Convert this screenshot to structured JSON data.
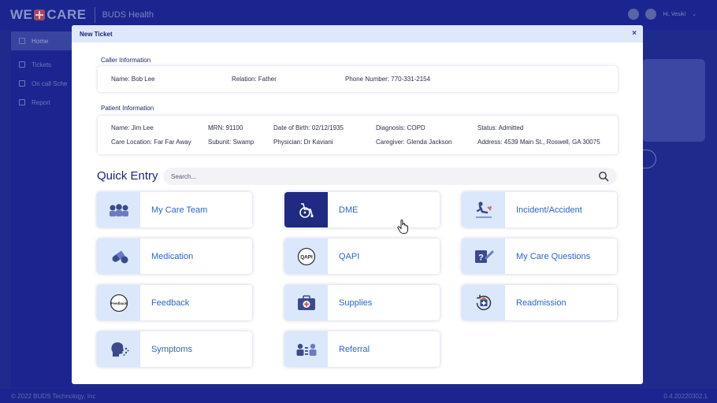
{
  "app": {
    "logo_text_left": "WE",
    "logo_text_right": "CARE",
    "brand": "BUDS Health",
    "greeting": "Hi, Vesikl"
  },
  "sidebar": {
    "items": [
      {
        "label": "Home",
        "icon": "home-icon"
      },
      {
        "label": "Tickets",
        "icon": "ticket-icon"
      },
      {
        "label": "On call Sche",
        "icon": "oncall-icon"
      },
      {
        "label": "Report",
        "icon": "report-icon"
      }
    ]
  },
  "footer": {
    "copyright": "© 2022 BUDS Technology, Inc",
    "version": "0.4.20220302.1"
  },
  "modal": {
    "title": "New Ticket",
    "close": "×",
    "caller": {
      "section_label": "Caller Information",
      "name": "Name: Bob Lee",
      "relation": "Relation: Father",
      "phone": "Phone Number: 770-331-2154"
    },
    "patient": {
      "section_label": "Patient Information",
      "name": "Name: Jim Lee",
      "mrn": "MRN: 91100",
      "dob": "Date of Birth: 02/12/1935",
      "diagnosis": "Diagnosis: COPD",
      "status": "Status: Admitted",
      "care_location": "Care Location: Far Far Away",
      "subunit": "Subunit: Swamp",
      "physician": "Physician: Dr Kaviani",
      "caregiver": "Caregiver: Glenda Jackson",
      "address": "Address: 4539 Main St., Roswell, GA 30075"
    },
    "quick_entry": {
      "title": "Quick Entry",
      "search_placeholder": "Search...",
      "tiles": [
        {
          "label": "My Care Team",
          "icon": "care-team-icon"
        },
        {
          "label": "DME",
          "icon": "wheelchair-icon",
          "selected": true
        },
        {
          "label": "Incident/Accident",
          "icon": "fall-icon"
        },
        {
          "label": "Medication",
          "icon": "pill-icon"
        },
        {
          "label": "QAPI",
          "icon": "qapi-icon"
        },
        {
          "label": "My Care Questions",
          "icon": "question-icon"
        },
        {
          "label": "Feedback",
          "icon": "feedback-icon"
        },
        {
          "label": "Supplies",
          "icon": "first-aid-kit-icon"
        },
        {
          "label": "Readmission",
          "icon": "readmission-icon"
        },
        {
          "label": "Symptoms",
          "icon": "cough-icon"
        },
        {
          "label": "Referral",
          "icon": "referral-icon"
        }
      ]
    },
    "qapi_icon_text": "QAPI",
    "feedback_icon_text": "Feedback"
  },
  "colors": {
    "accent": "#2a66c9",
    "navy": "#1b2475",
    "tile_icon_bg": "#dbe7fb",
    "selected_icon_bg": "#1f2b82"
  }
}
